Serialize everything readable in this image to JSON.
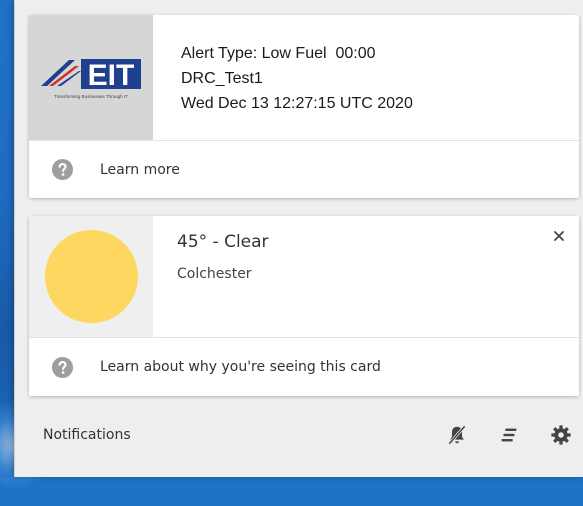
{
  "notification": {
    "logo_text": "EIT",
    "logo_tagline": "Transforming Businesses Through IT",
    "lines": [
      "Alert Type: Low Fuel  00:00",
      "DRC_Test1",
      "Wed Dec 13 12:27:15 UTC 2020"
    ],
    "learn_more_label": "Learn more"
  },
  "weather_card": {
    "temperature": "45° - Clear",
    "location": "Colchester",
    "learn_label": "Learn about why you're seeing this card",
    "icon": "sun-icon"
  },
  "footer": {
    "title": "Notifications",
    "icons": [
      "mute-icon",
      "sort-icon",
      "settings-icon"
    ]
  },
  "colors": {
    "panel_bg": "#eeeeee",
    "card_bg": "#ffffff",
    "sun": "#fdd75f",
    "desktop": "#1e73c8",
    "logo_blue": "#1f3f8f",
    "logo_red": "#d52b2b"
  }
}
